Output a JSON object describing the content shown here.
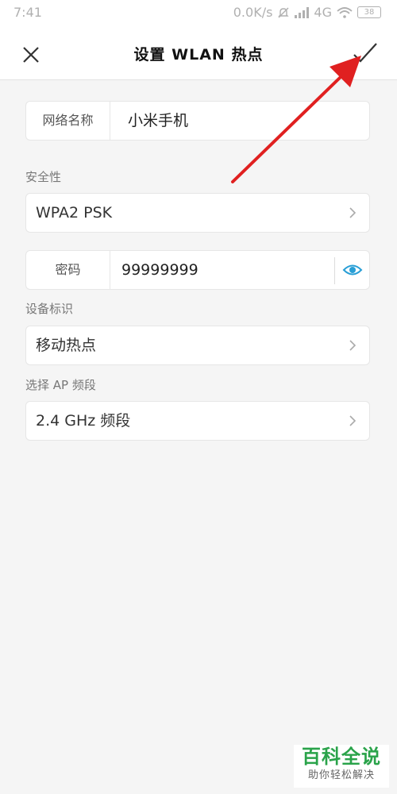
{
  "status_bar": {
    "time": "7:41",
    "network_speed": "0.0K/s",
    "network_type": "4G",
    "battery": "38"
  },
  "header": {
    "title": "设置 WLAN 热点",
    "close_icon": "close-icon",
    "confirm_icon": "check-icon"
  },
  "network_name": {
    "label": "网络名称",
    "value": "小米手机"
  },
  "security": {
    "section_label": "安全性",
    "value": "WPA2 PSK"
  },
  "password": {
    "label": "密码",
    "value": "99999999",
    "toggle_icon": "eye-icon"
  },
  "device_id": {
    "section_label": "设备标识",
    "value": "移动热点"
  },
  "ap_band": {
    "section_label": "选择 AP 频段",
    "value": "2.4 GHz 频段"
  },
  "watermark": {
    "main": "百科全说",
    "sub": "助你轻松解决"
  },
  "colors": {
    "accent_eye": "#2a9fd6",
    "arrow": "#e02020",
    "watermark_green": "#2aa34a"
  }
}
